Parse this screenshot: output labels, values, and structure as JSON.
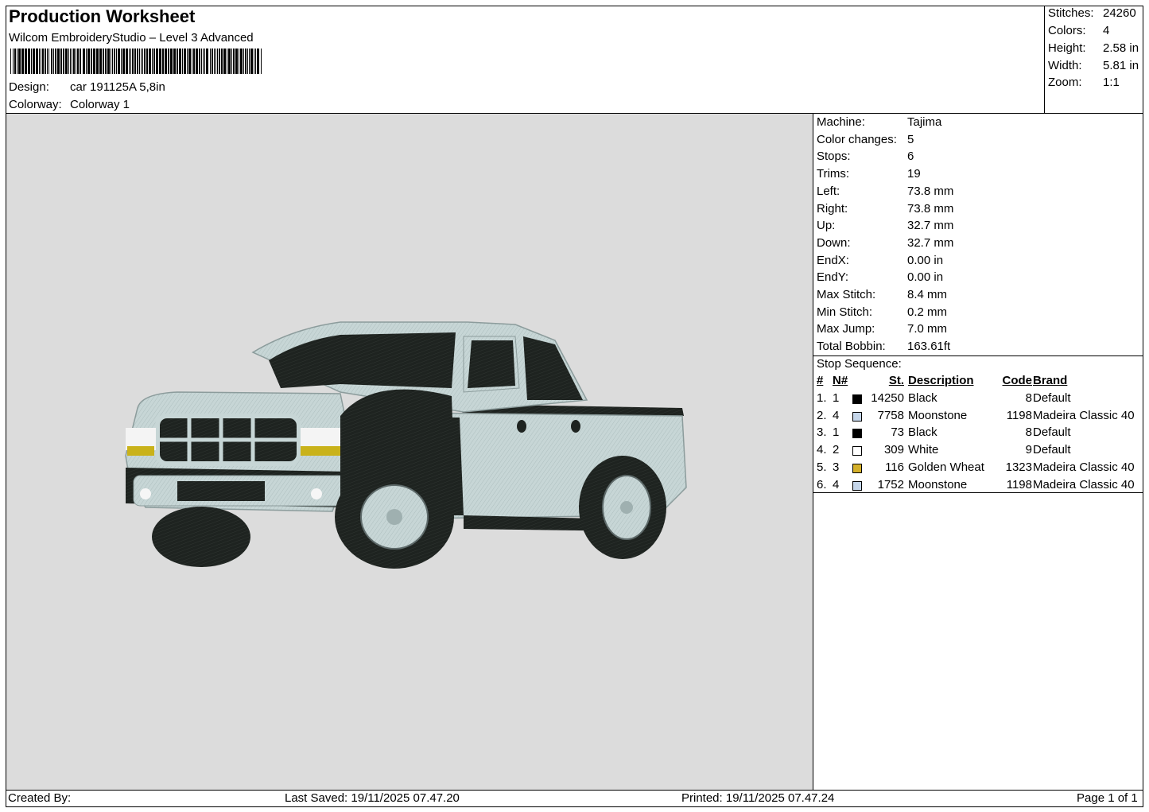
{
  "header": {
    "title": "Production Worksheet",
    "software": "Wilcom EmbroideryStudio – Level 3 Advanced",
    "design_label": "Design:",
    "design_value": "car 191125A 5,8in",
    "colorway_label": "Colorway:",
    "colorway_value": "Colorway 1"
  },
  "stats": [
    {
      "label": "Stitches:",
      "value": "24260"
    },
    {
      "label": "Colors:",
      "value": "4"
    },
    {
      "label": "Height:",
      "value": "2.58 in"
    },
    {
      "label": "Width:",
      "value": "5.81 in"
    },
    {
      "label": "Zoom:",
      "value": "1:1"
    }
  ],
  "machine_info": [
    {
      "label": "Machine:",
      "value": "Tajima"
    },
    {
      "label": "Color changes:",
      "value": "5"
    },
    {
      "label": "Stops:",
      "value": "6"
    },
    {
      "label": "Trims:",
      "value": "19"
    },
    {
      "label": "Left:",
      "value": "73.8 mm"
    },
    {
      "label": "Right:",
      "value": "73.8 mm"
    },
    {
      "label": "Up:",
      "value": "32.7 mm"
    },
    {
      "label": "Down:",
      "value": "32.7 mm"
    },
    {
      "label": "EndX:",
      "value": "0.00 in"
    },
    {
      "label": "EndY:",
      "value": "0.00 in"
    },
    {
      "label": "Max Stitch:",
      "value": "8.4 mm"
    },
    {
      "label": "Min Stitch:",
      "value": "0.2 mm"
    },
    {
      "label": "Max Jump:",
      "value": "7.0 mm"
    },
    {
      "label": "Total Bobbin:",
      "value": "163.61ft"
    }
  ],
  "stop_sequence": {
    "title": "Stop Sequence:",
    "headers": {
      "num": "#",
      "n": "N#",
      "st": "St.",
      "desc": "Description",
      "code": "Code",
      "brand": "Brand"
    },
    "rows": [
      {
        "num": "1.",
        "n": "1",
        "color": "#000000",
        "st": "14250",
        "desc": "Black",
        "code": "8",
        "brand": "Default"
      },
      {
        "num": "2.",
        "n": "4",
        "color": "#c5d6ea",
        "st": "7758",
        "desc": "Moonstone",
        "code": "1198",
        "brand": "Madeira Classic 40"
      },
      {
        "num": "3.",
        "n": "1",
        "color": "#000000",
        "st": "73",
        "desc": "Black",
        "code": "8",
        "brand": "Default"
      },
      {
        "num": "4.",
        "n": "2",
        "color": "#ffffff",
        "st": "309",
        "desc": "White",
        "code": "9",
        "brand": "Default"
      },
      {
        "num": "5.",
        "n": "3",
        "color": "#d4b02a",
        "st": "116",
        "desc": "Golden Wheat",
        "code": "1323",
        "brand": "Madeira Classic 40"
      },
      {
        "num": "6.",
        "n": "4",
        "color": "#c5d6ea",
        "st": "1752",
        "desc": "Moonstone",
        "code": "1198",
        "brand": "Madeira Classic 40"
      }
    ]
  },
  "footer": {
    "created_by": "Created By:",
    "last_saved": "Last Saved: 19/11/2025 07.47.20",
    "printed": "Printed: 19/11/2025 07.47.24",
    "page": "Page 1 of 1"
  },
  "colors": {
    "canvas_bg": "#dcdcdc",
    "body_thread": "#c7d6d6",
    "dark_thread": "#1e2320",
    "gold_thread": "#c9b21a"
  }
}
